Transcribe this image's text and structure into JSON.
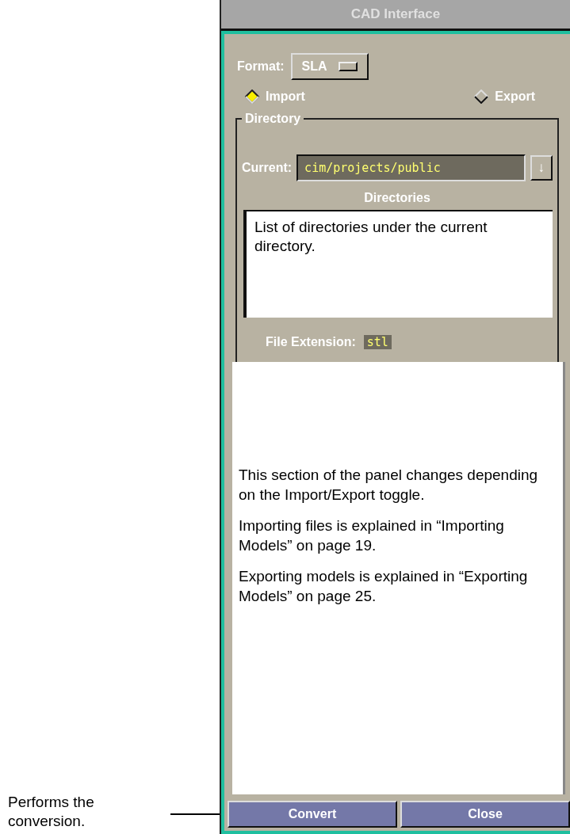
{
  "callout": {
    "text": "Performs the conversion."
  },
  "window": {
    "title": "CAD Interface"
  },
  "format": {
    "label": "Format:",
    "value": "SLA"
  },
  "mode": [
    {
      "label": "Import",
      "selected": true
    },
    {
      "label": "Export",
      "selected": false
    }
  ],
  "directory": {
    "title": "Directory",
    "current_label": "Current:",
    "current_value": "cim/projects/public",
    "arrow": "↓",
    "list_title": "Directories",
    "list_note": "List of directories under the current directory.",
    "extension_label": "File Extension:",
    "extension_value": "stl"
  },
  "section_notes": [
    "This section of the panel changes depending on the Import/Export toggle.",
    "Importing files is explained in “Importing Models” on page 19.",
    "Exporting models is explained in “Exporting Models” on page 25."
  ],
  "buttons": [
    "Convert",
    "Close"
  ]
}
